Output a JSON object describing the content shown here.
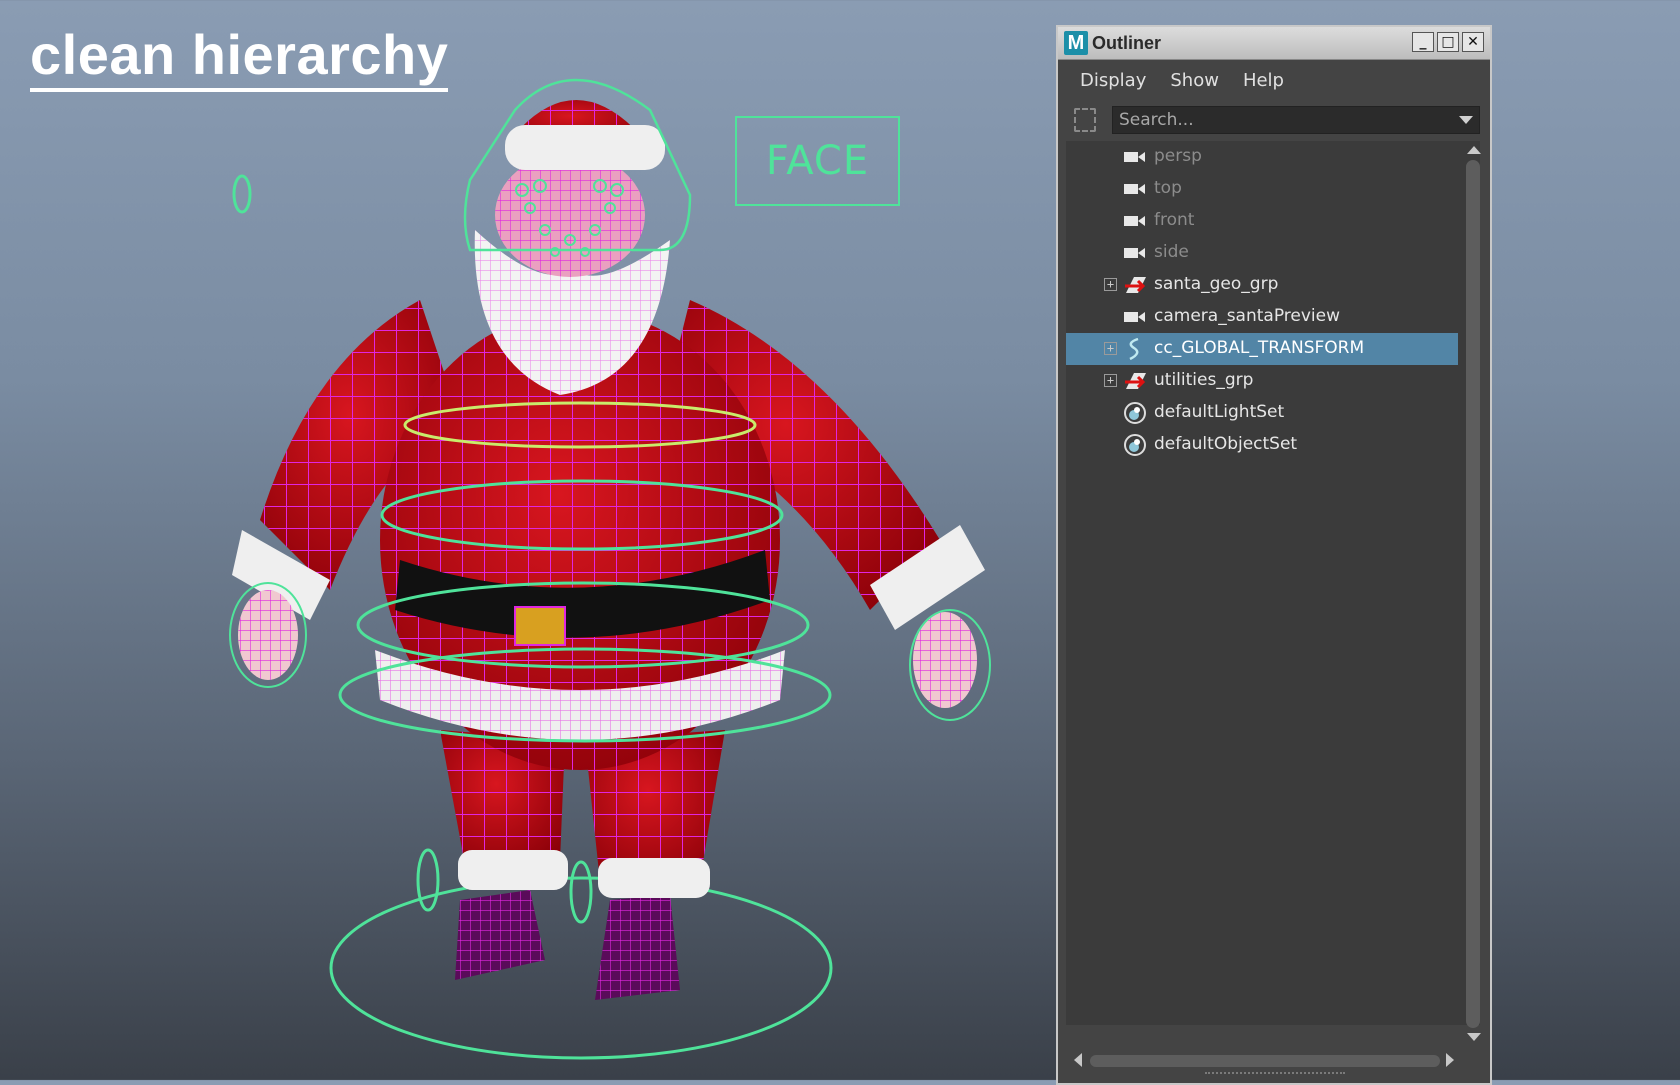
{
  "slide": {
    "title": "clean hierarchy"
  },
  "viewport": {
    "face_label": "FACE"
  },
  "outliner": {
    "window_title": "Outliner",
    "app_logo": "M",
    "window_buttons": {
      "minimize": "_",
      "maximize": "□",
      "close": "✕"
    },
    "menu": [
      "Display",
      "Show",
      "Help"
    ],
    "search": {
      "placeholder": "Search..."
    },
    "items": [
      {
        "label": "persp",
        "icon": "camera-icon",
        "expandable": false,
        "dim": true,
        "selected": false
      },
      {
        "label": "top",
        "icon": "camera-icon",
        "expandable": false,
        "dim": true,
        "selected": false
      },
      {
        "label": "front",
        "icon": "camera-icon",
        "expandable": false,
        "dim": true,
        "selected": false
      },
      {
        "label": "side",
        "icon": "camera-icon",
        "expandable": false,
        "dim": true,
        "selected": false
      },
      {
        "label": "santa_geo_grp",
        "icon": "group-icon",
        "expandable": true,
        "dim": false,
        "selected": false
      },
      {
        "label": "camera_santaPreview",
        "icon": "camera-icon",
        "expandable": false,
        "dim": false,
        "selected": false
      },
      {
        "label": "cc_GLOBAL_TRANSFORM",
        "icon": "curve-icon",
        "expandable": true,
        "dim": false,
        "selected": true
      },
      {
        "label": "utilities_grp",
        "icon": "group-icon",
        "expandable": true,
        "dim": false,
        "selected": false
      },
      {
        "label": "defaultLightSet",
        "icon": "set-icon",
        "expandable": false,
        "dim": false,
        "selected": false
      },
      {
        "label": "defaultObjectSet",
        "icon": "set-icon",
        "expandable": false,
        "dim": false,
        "selected": false
      }
    ]
  },
  "colors": {
    "selection": "#5285a6",
    "control_curve": "#4fe39a",
    "wireframe": "#e026e0",
    "suit_red": "#c4101a"
  }
}
